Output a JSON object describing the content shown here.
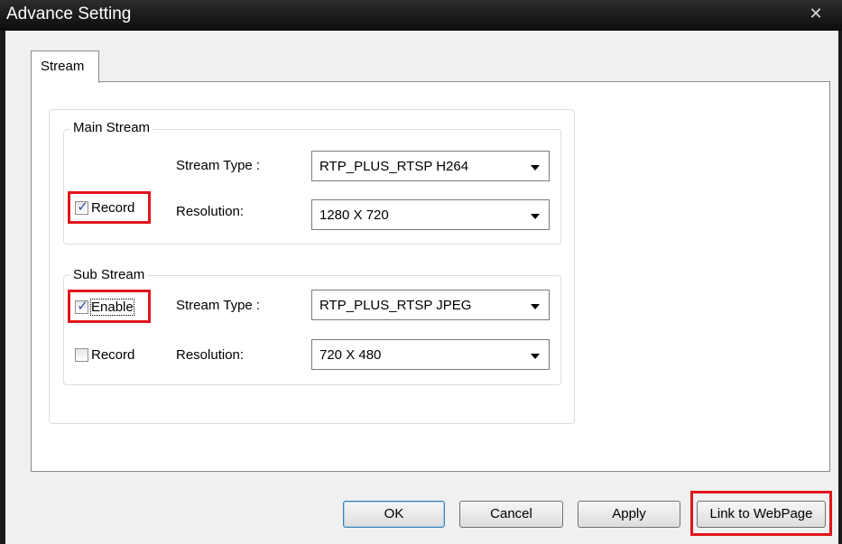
{
  "window": {
    "title": "Advance Setting",
    "close_glyph": "✕"
  },
  "tabs": [
    {
      "label": "Stream",
      "active": true
    }
  ],
  "main_stream": {
    "legend": "Main Stream",
    "stream_type_label": "Stream Type :",
    "stream_type_value": "RTP_PLUS_RTSP H264",
    "resolution_label": "Resolution:",
    "resolution_value": "1280 X 720",
    "record_label": "Record",
    "record_checked": true
  },
  "sub_stream": {
    "legend": "Sub Stream",
    "enable_label": "Enable",
    "enable_checked": true,
    "stream_type_label": "Stream Type :",
    "stream_type_value": "RTP_PLUS_RTSP JPEG",
    "record_label": "Record",
    "record_checked": false,
    "resolution_label": "Resolution:",
    "resolution_value": "720 X 480"
  },
  "buttons": {
    "ok": "OK",
    "cancel": "Cancel",
    "apply": "Apply",
    "link": "Link to WebPage"
  },
  "colors": {
    "highlight": "#e0151c",
    "titlebar": "#111111",
    "dialog_bg": "#f0f0f0"
  },
  "icons": {
    "close": "close-icon",
    "dropdown": "chevron-down-icon",
    "check": "checkmark-icon"
  }
}
